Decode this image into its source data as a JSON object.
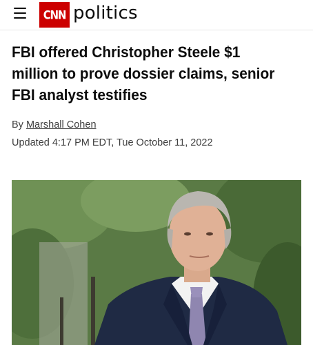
{
  "header": {
    "menu_icon": "hamburger-menu-icon",
    "logo_text": "CNN",
    "section": "politics",
    "brand_color": "#cc0000"
  },
  "article": {
    "headline": "FBI offered Christopher Steele $1 million to prove dossier claims, senior FBI analyst testifies",
    "byline_prefix": "By",
    "author": "Marshall Cohen",
    "updated": "Updated 4:17 PM EDT, Tue October 11, 2022"
  },
  "photo": {
    "subject": "Man with gray hair in navy suit, white shirt and lavender tie, greenery in background"
  }
}
